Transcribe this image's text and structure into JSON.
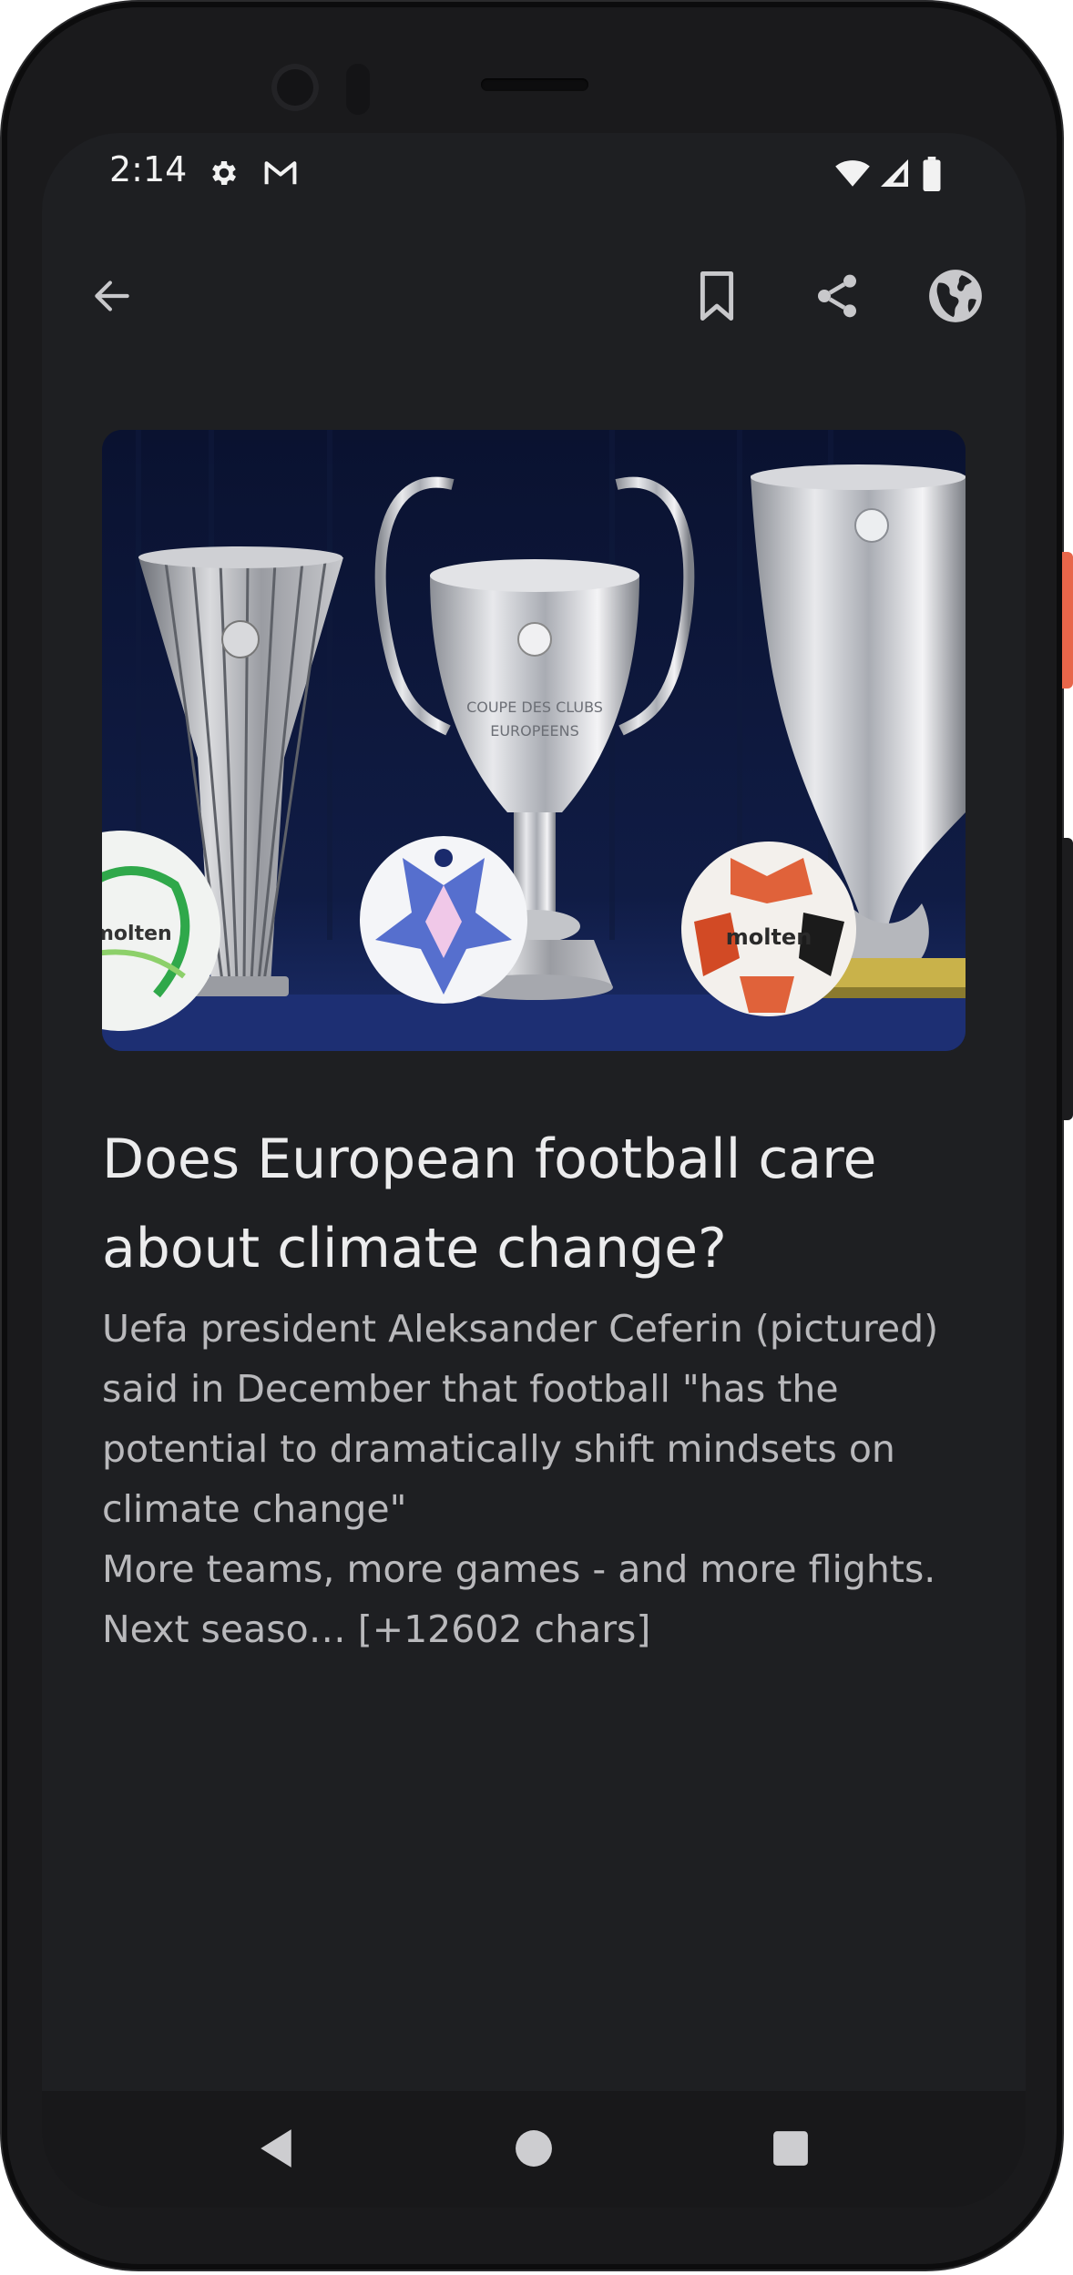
{
  "status_bar": {
    "time": "2:14",
    "icons": [
      "settings-icon",
      "gmail-icon",
      "wifi-icon",
      "signal-icon",
      "battery-icon"
    ]
  },
  "app_bar": {
    "icons": [
      "back-arrow-icon",
      "bookmark-icon",
      "share-icon",
      "globe-icon"
    ]
  },
  "article": {
    "title": "Does European football care about climate change?",
    "body": "Uefa president Aleksander Ceferin (pictured) said in December that football \"has the potential to dramatically shift mindsets on climate change\"\nMore teams, more games - and more flights. Next seaso… [+12602 chars]"
  },
  "nav_bar": {
    "icons": [
      "nav-back-icon",
      "nav-home-icon",
      "nav-recents-icon"
    ]
  },
  "colors": {
    "background": "#1e1f22",
    "title": "#ececed",
    "body": "#b9b9bc",
    "icon": "#c8c8cb",
    "side_button_accent": "#e8664a"
  }
}
